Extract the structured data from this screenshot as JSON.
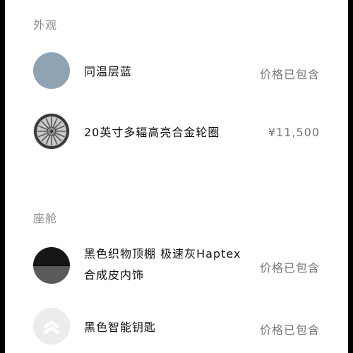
{
  "sections": [
    {
      "title": "外观",
      "items": [
        {
          "name": "同温层蓝",
          "price": "价格已包含",
          "icon": "paint-swatch-icon",
          "color": "#8fa3b2"
        },
        {
          "name": "20英寸多辐高亮合金轮圈",
          "price": "¥11,500",
          "icon": "wheel-icon"
        }
      ]
    },
    {
      "title": "座舱",
      "items": [
        {
          "name_line1": "黑色织物顶棚 极速灰Haptex",
          "name_line2": "合成皮内饰",
          "price": "价格已包含",
          "icon": "interior-swatch-icon"
        },
        {
          "name": "黑色智能钥匙",
          "price": "价格已包含",
          "icon": "key-icon"
        }
      ]
    }
  ]
}
